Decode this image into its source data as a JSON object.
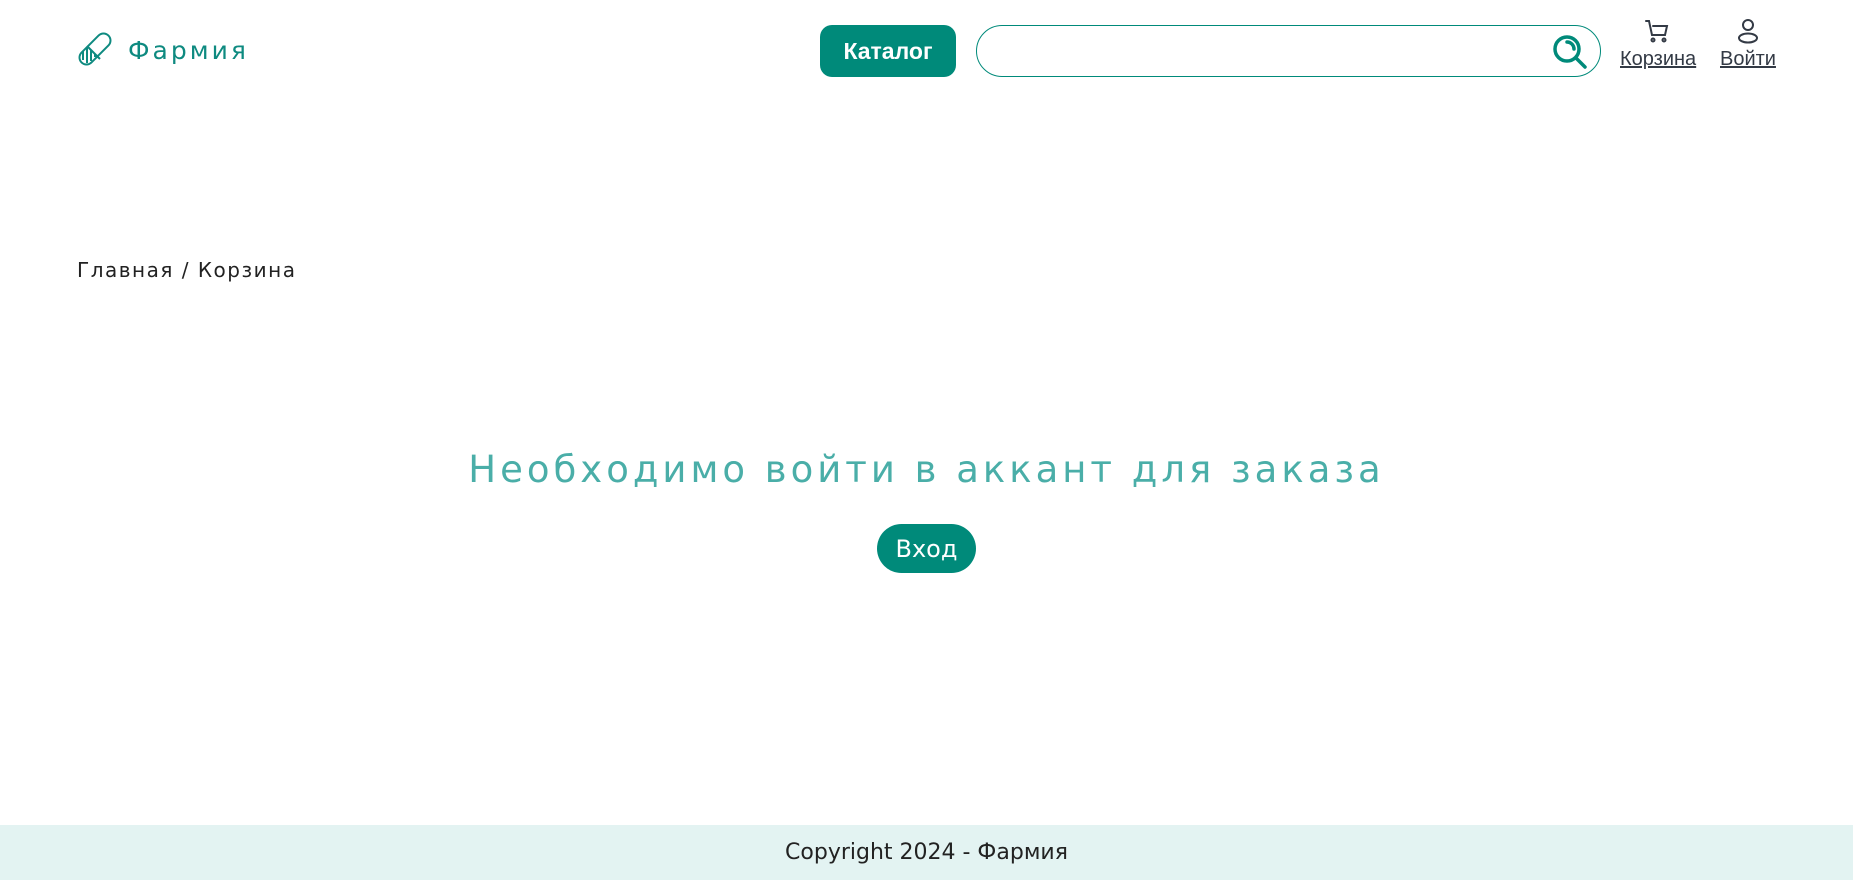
{
  "header": {
    "logo_text": "Фармия",
    "catalog_label": "Каталог",
    "search_placeholder": "",
    "cart_label": "Корзина",
    "login_label": "Войти"
  },
  "breadcrumb": {
    "home": "Главная",
    "separator": "/",
    "current": "Корзина"
  },
  "main": {
    "message": "Необходимо войти в аккант для заказа",
    "login_button": "Вход"
  },
  "footer": {
    "copyright": "Copyright 2024 - Фармия"
  },
  "colors": {
    "accent": "#008a7a",
    "heading": "#4aaea8",
    "footer_bg": "#e3f3f2"
  }
}
